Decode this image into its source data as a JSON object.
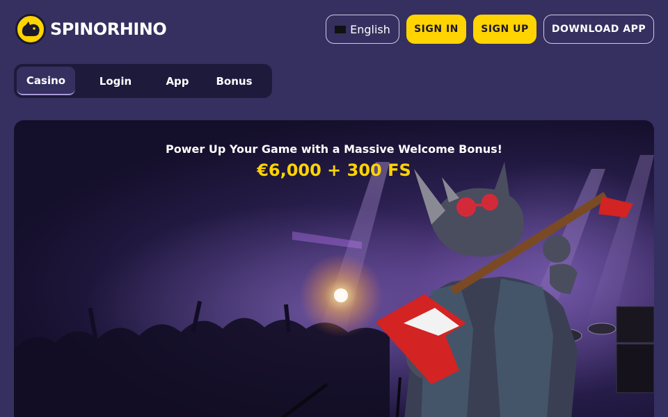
{
  "brand": {
    "name": "SPINORHINO",
    "accent": "#ffd400",
    "background": "#35305f"
  },
  "header": {
    "language": {
      "label": "English",
      "icon": "flag-icon"
    },
    "signin_label": "SIGN IN",
    "signup_label": "SIGN UP",
    "download_label": "DOWNLOAD APP"
  },
  "tabs": [
    {
      "label": "Casino",
      "active": true
    },
    {
      "label": "Login",
      "active": false
    },
    {
      "label": "App",
      "active": false
    },
    {
      "label": "Bonus",
      "active": false
    }
  ],
  "hero": {
    "title": "Power Up Your Game with a Massive Welcome Bonus!",
    "bonus": "€6,000 + 300 FS",
    "image": "rhino-guitarist-concert-illustration"
  }
}
